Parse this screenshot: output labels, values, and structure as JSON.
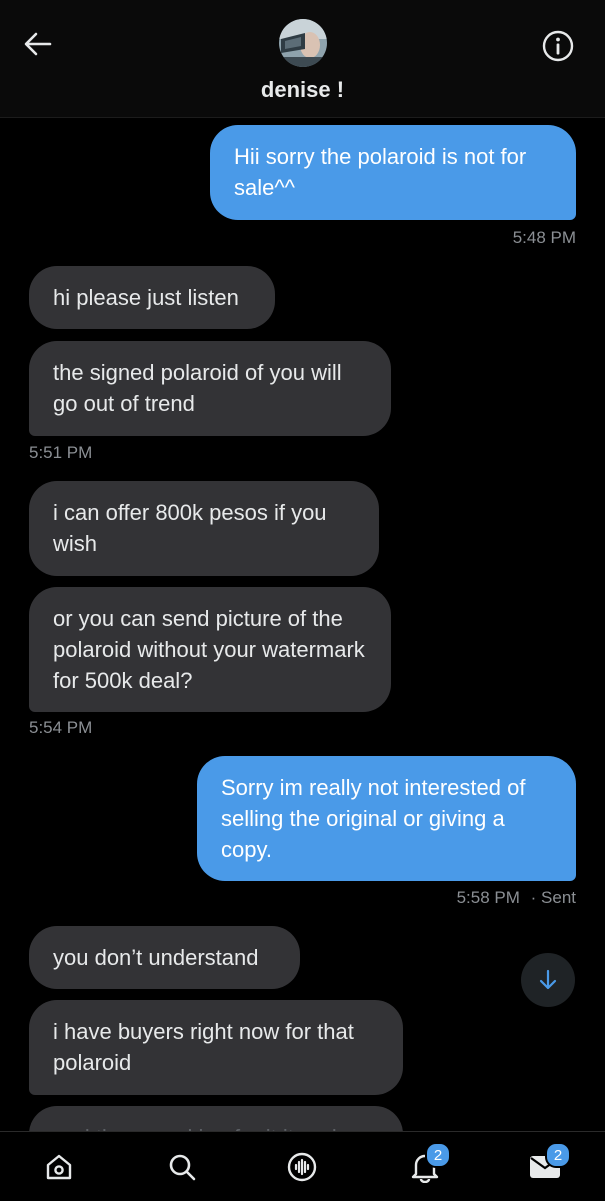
{
  "header": {
    "contact_name": "denise !",
    "back_icon": "arrow-left-icon",
    "info_icon": "info-icon"
  },
  "messages": [
    {
      "dir": "sent",
      "text": "Hii sorry the polaroid is not for sale^^"
    },
    {
      "ts": "5:48 PM"
    },
    {
      "dir": "recv",
      "text": "hi please just listen"
    },
    {
      "dir": "recv",
      "text": "the signed polaroid of you will go out of trend"
    },
    {
      "ts": "5:51 PM"
    },
    {
      "dir": "recv",
      "text": "i can offer 800k pesos if you wish"
    },
    {
      "dir": "recv",
      "text": "or you can send picture of the polaroid without your watermark for 500k deal?"
    },
    {
      "ts": "5:54 PM"
    },
    {
      "dir": "sent",
      "text": "Sorry im really not interested of selling the original or giving a copy."
    },
    {
      "ts": "5:58 PM",
      "status": "· Sent"
    },
    {
      "dir": "recv",
      "text": "you don’t understand"
    },
    {
      "dir": "recv",
      "text": "i have buyers right now for that polaroid"
    },
    {
      "dir": "recv",
      "text": "and the ... making for it it and"
    }
  ],
  "tabbar": {
    "notifications_badge": "2",
    "messages_badge": "2",
    "icons": [
      "home-icon",
      "search-icon",
      "spaces-icon",
      "bell-icon",
      "envelope-icon"
    ]
  },
  "colors": {
    "sent_bubble": "#4a9ae8",
    "recv_bubble": "#333336",
    "background": "#000000",
    "timestamp": "#8b8f94"
  }
}
